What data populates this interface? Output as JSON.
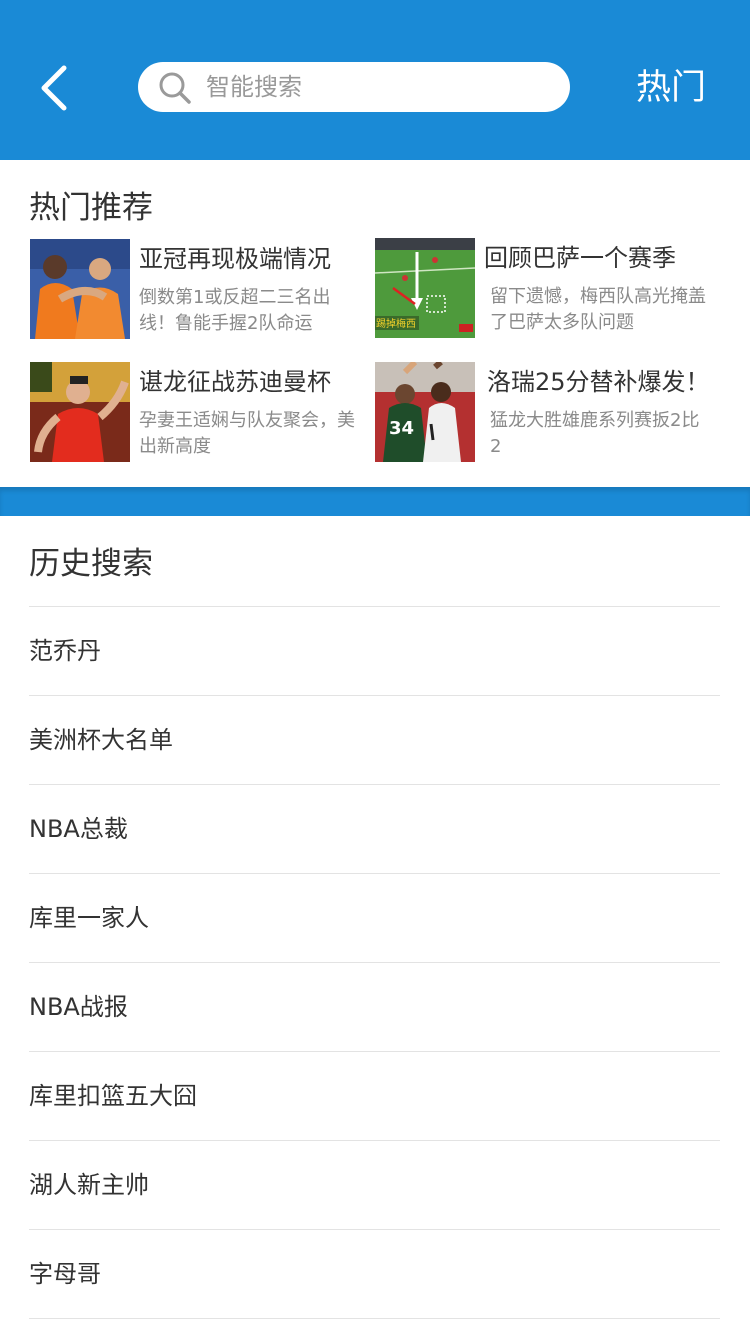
{
  "header": {
    "back_icon": "chevron-left-icon",
    "search": {
      "placeholder": "智能搜索",
      "icon": "search-icon"
    },
    "hot_label": "热门",
    "bg_color": "#1a8ad6"
  },
  "hot": {
    "title": "热门推荐",
    "items": [
      {
        "headline": "亚冠再现极端情况",
        "desc": "倒数第1或反超二三名出线！鲁能手握2队命运"
      },
      {
        "headline": "回顾巴萨一个赛季",
        "desc": "留下遗憾，梅西队高光掩盖了巴萨太多队问题",
        "thumb_caption": "踢掉梅西"
      },
      {
        "headline": "谌龙征战苏迪曼杯",
        "desc": "孕妻王适娴与队友聚会，美出新高度"
      },
      {
        "headline": "洛瑞25分替补爆发！",
        "desc": "猛龙大胜雄鹿系列赛扳2比2",
        "thumb_caption": "34"
      }
    ]
  },
  "history": {
    "title": "历史搜索",
    "items": [
      "范乔丹",
      "美洲杯大名单",
      "NBA总裁",
      "库里一家人",
      "NBA战报",
      "库里扣篮五大囧",
      "湖人新主帅",
      "字母哥"
    ]
  }
}
